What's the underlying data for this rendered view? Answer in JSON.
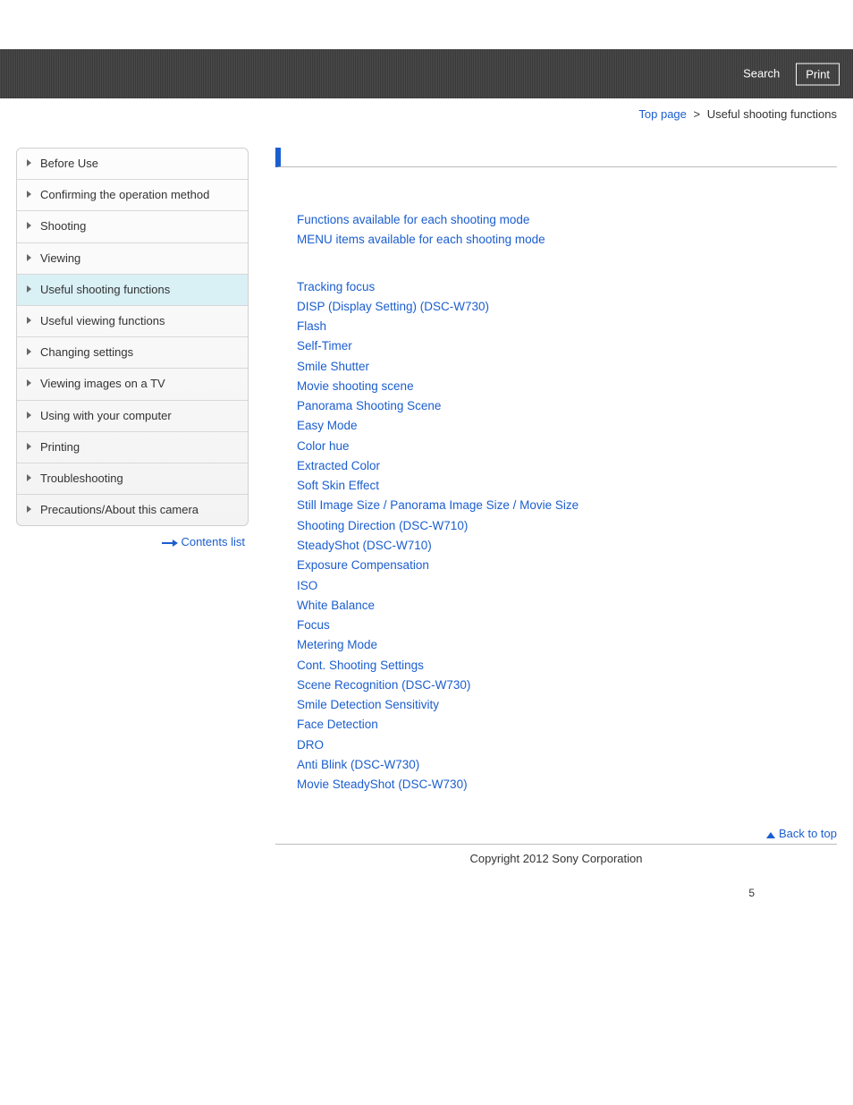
{
  "header": {
    "search_label": "Search",
    "print_label": "Print"
  },
  "breadcrumb": {
    "top_label": "Top page",
    "current": "Useful shooting functions"
  },
  "sidebar": {
    "items": [
      {
        "label": "Before Use",
        "active": false
      },
      {
        "label": "Confirming the operation method",
        "active": false
      },
      {
        "label": "Shooting",
        "active": false
      },
      {
        "label": "Viewing",
        "active": false
      },
      {
        "label": "Useful shooting functions",
        "active": true
      },
      {
        "label": "Useful viewing functions",
        "active": false
      },
      {
        "label": "Changing settings",
        "active": false
      },
      {
        "label": "Viewing images on a TV",
        "active": false
      },
      {
        "label": "Using with your computer",
        "active": false
      },
      {
        "label": "Printing",
        "active": false
      },
      {
        "label": "Troubleshooting",
        "active": false
      },
      {
        "label": "Precautions/About this camera",
        "active": false
      }
    ],
    "contents_list_label": "Contents list"
  },
  "main": {
    "group1": [
      "Functions available for each shooting mode",
      "MENU items available for each shooting mode"
    ],
    "group2": [
      "Tracking focus",
      "DISP (Display Setting) (DSC-W730)",
      "Flash",
      "Self-Timer",
      "Smile Shutter",
      "Movie shooting scene",
      "Panorama Shooting Scene",
      "Easy Mode",
      "Color hue",
      "Extracted Color",
      "Soft Skin Effect",
      "Still Image Size / Panorama Image Size / Movie Size",
      "Shooting Direction (DSC-W710)",
      "SteadyShot (DSC-W710)",
      "Exposure Compensation",
      "ISO",
      "White Balance",
      "Focus",
      "Metering Mode",
      "Cont. Shooting Settings",
      "Scene Recognition (DSC-W730)",
      "Smile Detection Sensitivity",
      "Face Detection",
      "DRO",
      "Anti Blink (DSC-W730)",
      "Movie SteadyShot (DSC-W730)"
    ]
  },
  "footer": {
    "back_to_top": "Back to top",
    "copyright": "Copyright 2012 Sony Corporation",
    "page_number": "5"
  }
}
